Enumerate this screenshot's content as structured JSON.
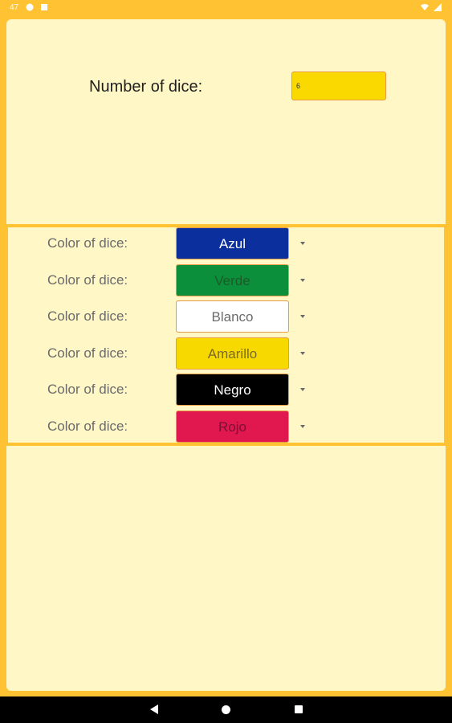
{
  "status": {
    "time": "47"
  },
  "number_of_dice": {
    "label": "Number of dice:",
    "value": "6"
  },
  "dice_rows": [
    {
      "label": "Color of dice:",
      "selected": "Azul",
      "bg": "#0B2F9C",
      "fg": "#FFFFFF"
    },
    {
      "label": "Color of dice:",
      "selected": "Verde",
      "bg": "#0B8F3A",
      "fg": "#1E5A2A"
    },
    {
      "label": "Color of dice:",
      "selected": "Blanco",
      "bg": "#FFFFFF",
      "fg": "#6B6B6B"
    },
    {
      "label": "Color of dice:",
      "selected": "Amarillo",
      "bg": "#F7D900",
      "fg": "#7A6A2A"
    },
    {
      "label": "Color of dice:",
      "selected": "Negro",
      "bg": "#000000",
      "fg": "#FFFFFF"
    },
    {
      "label": "Color of dice:",
      "selected": "Rojo",
      "bg": "#E0184F",
      "fg": "#7A1032"
    }
  ],
  "colors": {
    "accent": "#FFC233",
    "panel": "#FFF7C6"
  },
  "icons": [
    "wifi-icon",
    "battery-icon",
    "back-icon",
    "home-icon",
    "recents-icon",
    "dropdown-arrow-icon"
  ]
}
